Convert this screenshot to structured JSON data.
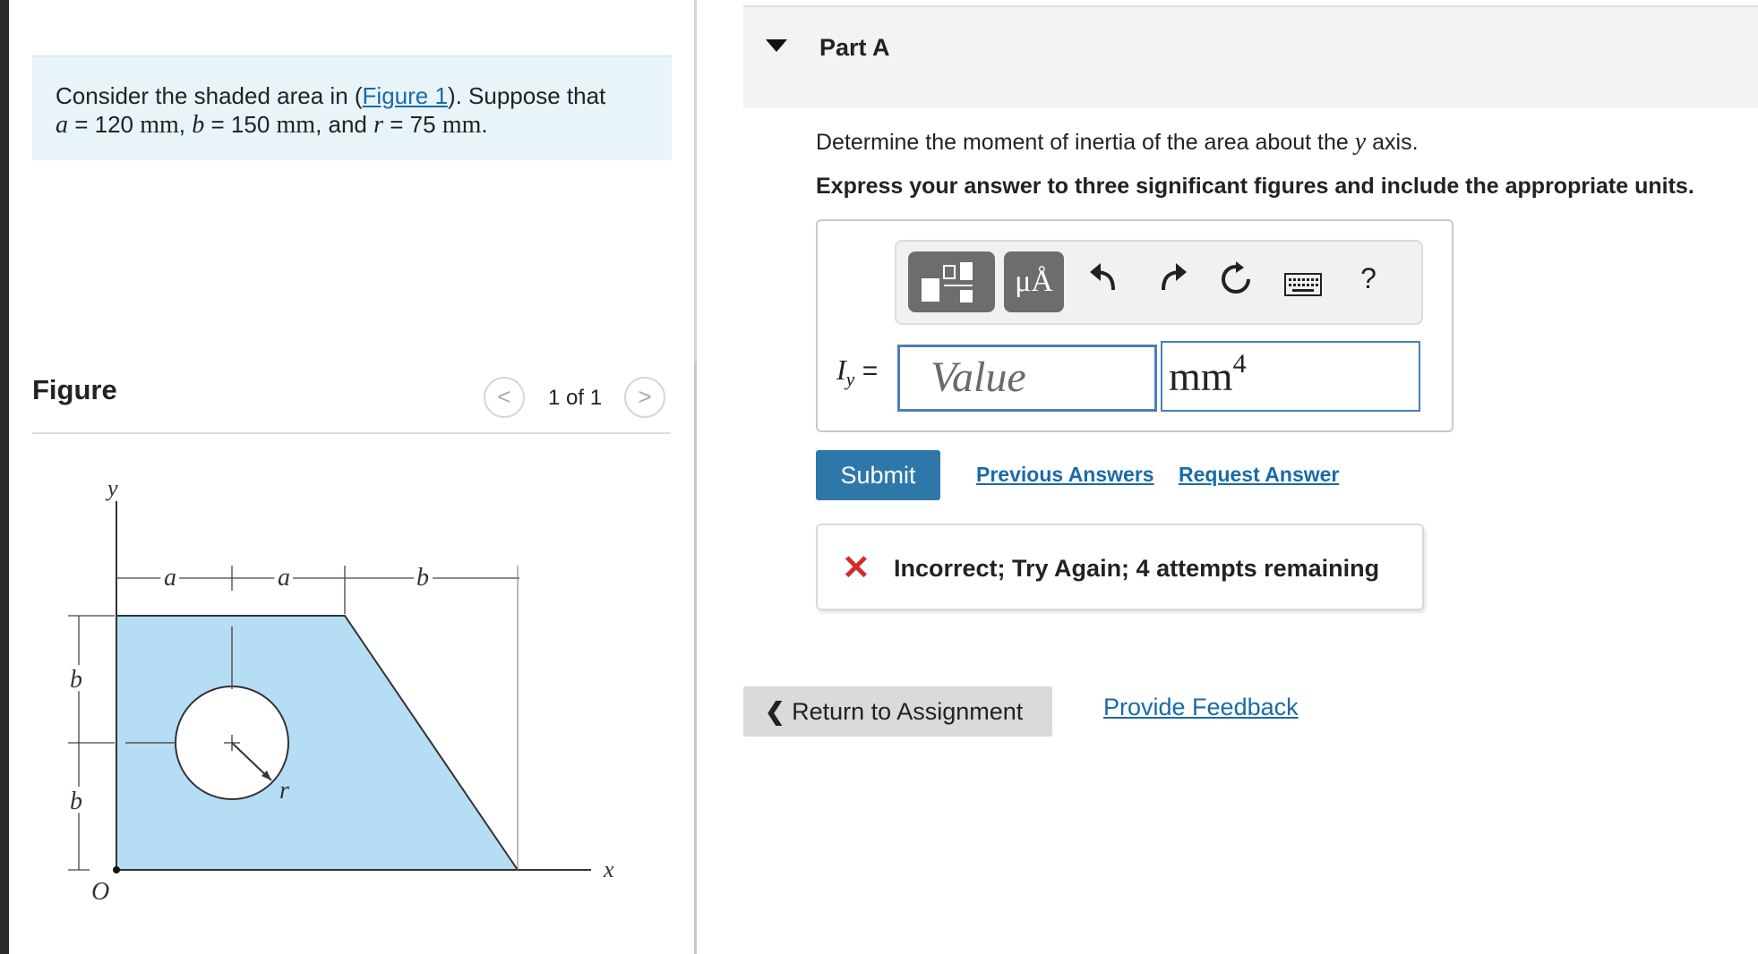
{
  "problem": {
    "text_consider": "Consider the shaded area in (",
    "figure_link": "Figure 1",
    "text_suppose": "). Suppose that",
    "a_var": "a",
    "a_val": " = 120 ",
    "b_var": "b",
    "b_val": " = 150 ",
    "and": ", and ",
    "r_var": "r",
    "r_val": " = 75 ",
    "unit": "mm",
    "comma": ",",
    "period": "."
  },
  "figure": {
    "title": "Figure",
    "page": "1 of 1",
    "prev_icon": "chevron-left-icon",
    "next_icon": "chevron-right-icon",
    "labels": {
      "y": "y",
      "x": "x",
      "o": "O",
      "a1": "a",
      "a2": "a",
      "b_top": "b",
      "b1": "b",
      "b2": "b",
      "r": "r"
    },
    "fill_color": "#b5ddf3"
  },
  "part": {
    "title": "Part A",
    "question_pre": "Determine the moment of inertia of the area about the ",
    "question_var": "y",
    "question_post": " axis.",
    "instruction": "Express your answer to three significant figures and include the appropriate units."
  },
  "toolbar": {
    "templates_icon": "templates-icon",
    "units_label": "μÅ",
    "undo_icon": "undo-icon",
    "redo_icon": "redo-icon",
    "reset_icon": "reset-icon",
    "keyboard_icon": "keyboard-icon",
    "help_label": "?"
  },
  "answer": {
    "variable": "I",
    "subscript": "y",
    "equals": "=",
    "value_placeholder": "Value",
    "unit_base": "mm",
    "unit_exp": "4"
  },
  "actions": {
    "submit": "Submit",
    "previous_answers": "Previous Answers",
    "request_answer": "Request Answer"
  },
  "feedback": {
    "icon": "close-icon",
    "message": "Incorrect; Try Again; 4 attempts remaining",
    "color": "#d42b2b"
  },
  "footer": {
    "return_label": "Return to Assignment",
    "provide_feedback": "Provide Feedback"
  },
  "colors": {
    "accent": "#2d78a8",
    "link": "#1a6aa8",
    "problem_bg": "#e8f4f8"
  }
}
